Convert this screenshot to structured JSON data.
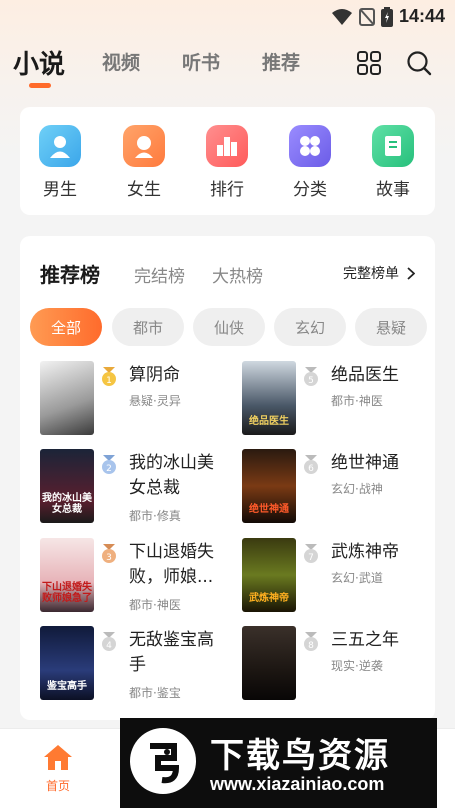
{
  "status_bar": {
    "time": "14:44"
  },
  "top_nav": {
    "tabs": [
      {
        "label": "小说"
      },
      {
        "label": "视频"
      },
      {
        "label": "听书"
      },
      {
        "label": "推荐"
      }
    ],
    "accent_color": "#ff6a2a",
    "icons": [
      "grid-icon",
      "search-icon"
    ]
  },
  "quick_entries": [
    {
      "label": "男生",
      "icon": "male-icon",
      "color": "#4fb7f0"
    },
    {
      "label": "女生",
      "icon": "female-icon",
      "color": "#ff8a50"
    },
    {
      "label": "排行",
      "icon": "ranking-icon",
      "color": "#ff6a6a"
    },
    {
      "label": "分类",
      "icon": "category-icon",
      "color": "#7a6cf0"
    },
    {
      "label": "故事",
      "icon": "story-icon",
      "color": "#3ccf8e"
    }
  ],
  "ranking": {
    "tabs": [
      {
        "label": "推荐榜"
      },
      {
        "label": "完结榜"
      },
      {
        "label": "大热榜"
      }
    ],
    "more_label": "完整榜单",
    "categories": [
      {
        "label": "全部"
      },
      {
        "label": "都市"
      },
      {
        "label": "仙侠"
      },
      {
        "label": "玄幻"
      },
      {
        "label": "悬疑"
      }
    ],
    "books": [
      {
        "rank": "1",
        "title": "算阴命",
        "tags": "悬疑·灵异"
      },
      {
        "rank": "2",
        "title": "我的冰山美女总裁",
        "tags": "都市·修真",
        "cover_text": "我的冰山美女总裁"
      },
      {
        "rank": "3",
        "title": "下山退婚失败，师娘...",
        "tags": "都市·神医",
        "cover_text": "下山退婚失败师娘急了"
      },
      {
        "rank": "4",
        "title": "无敌鉴宝高手",
        "tags": "都市·鉴宝",
        "cover_text": "鉴宝高手"
      },
      {
        "rank": "5",
        "title": "绝品医生",
        "tags": "都市·神医",
        "cover_text": "绝品医生"
      },
      {
        "rank": "6",
        "title": "绝世神通",
        "tags": "玄幻·战神",
        "cover_text": "绝世神通"
      },
      {
        "rank": "7",
        "title": "武炼神帝",
        "tags": "玄幻·武道",
        "cover_text": "武炼神帝"
      },
      {
        "rank": "8",
        "title": "三五之年",
        "tags": "现实·逆袭"
      }
    ]
  },
  "bottom_nav": {
    "home_label": "首页"
  },
  "watermark": {
    "title": "下载鸟资源",
    "url": "www.xiazainiao.com"
  }
}
